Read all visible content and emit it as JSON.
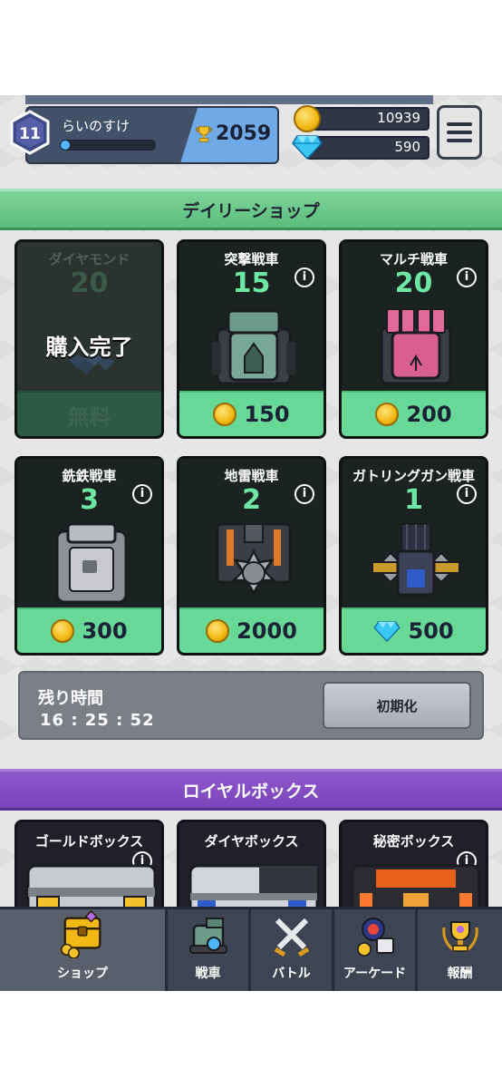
{
  "player": {
    "level": "11",
    "name": "らいのすけ",
    "trophies": "2059",
    "xp_progress": 0.1
  },
  "currency": {
    "coins": "10939",
    "gems": "590"
  },
  "daily_shop": {
    "title": "デイリーショップ",
    "items": [
      {
        "name": "ダイヤモンド",
        "count": "20",
        "status": "購入完了",
        "price": "無料",
        "currency": "free"
      },
      {
        "name": "突撃戦車",
        "count": "15",
        "price": "150",
        "currency": "coin"
      },
      {
        "name": "マルチ戦車",
        "count": "20",
        "price": "200",
        "currency": "coin"
      },
      {
        "name": "銑鉄戦車",
        "count": "3",
        "price": "300",
        "currency": "coin"
      },
      {
        "name": "地雷戦車",
        "count": "2",
        "price": "2000",
        "currency": "coin"
      },
      {
        "name": "ガトリングガン戦車",
        "count": "1",
        "price": "500",
        "currency": "gem"
      }
    ],
    "timer_label": "残り時間",
    "timer_value": "16 : 25 : 52",
    "reset_label": "初期化"
  },
  "royal_box": {
    "title": "ロイヤルボックス",
    "boxes": [
      {
        "name": "ゴールドボックス"
      },
      {
        "name": "ダイヤボックス"
      },
      {
        "name": "秘密ボックス"
      }
    ]
  },
  "nav": {
    "items": [
      {
        "label": "ショップ",
        "icon": "treasure-chest-icon"
      },
      {
        "label": "戦車",
        "icon": "tank-icon"
      },
      {
        "label": "バトル",
        "icon": "crossed-swords-icon"
      },
      {
        "label": "アーケード",
        "icon": "arcade-icon"
      },
      {
        "label": "報酬",
        "icon": "trophy-icon"
      }
    ],
    "active": "ショップ"
  },
  "colors": {
    "daily_banner": "#5bbd7c",
    "royal_banner": "#7b45ba",
    "price_bar": "#68d897",
    "count_text": "#6ee7a4"
  }
}
